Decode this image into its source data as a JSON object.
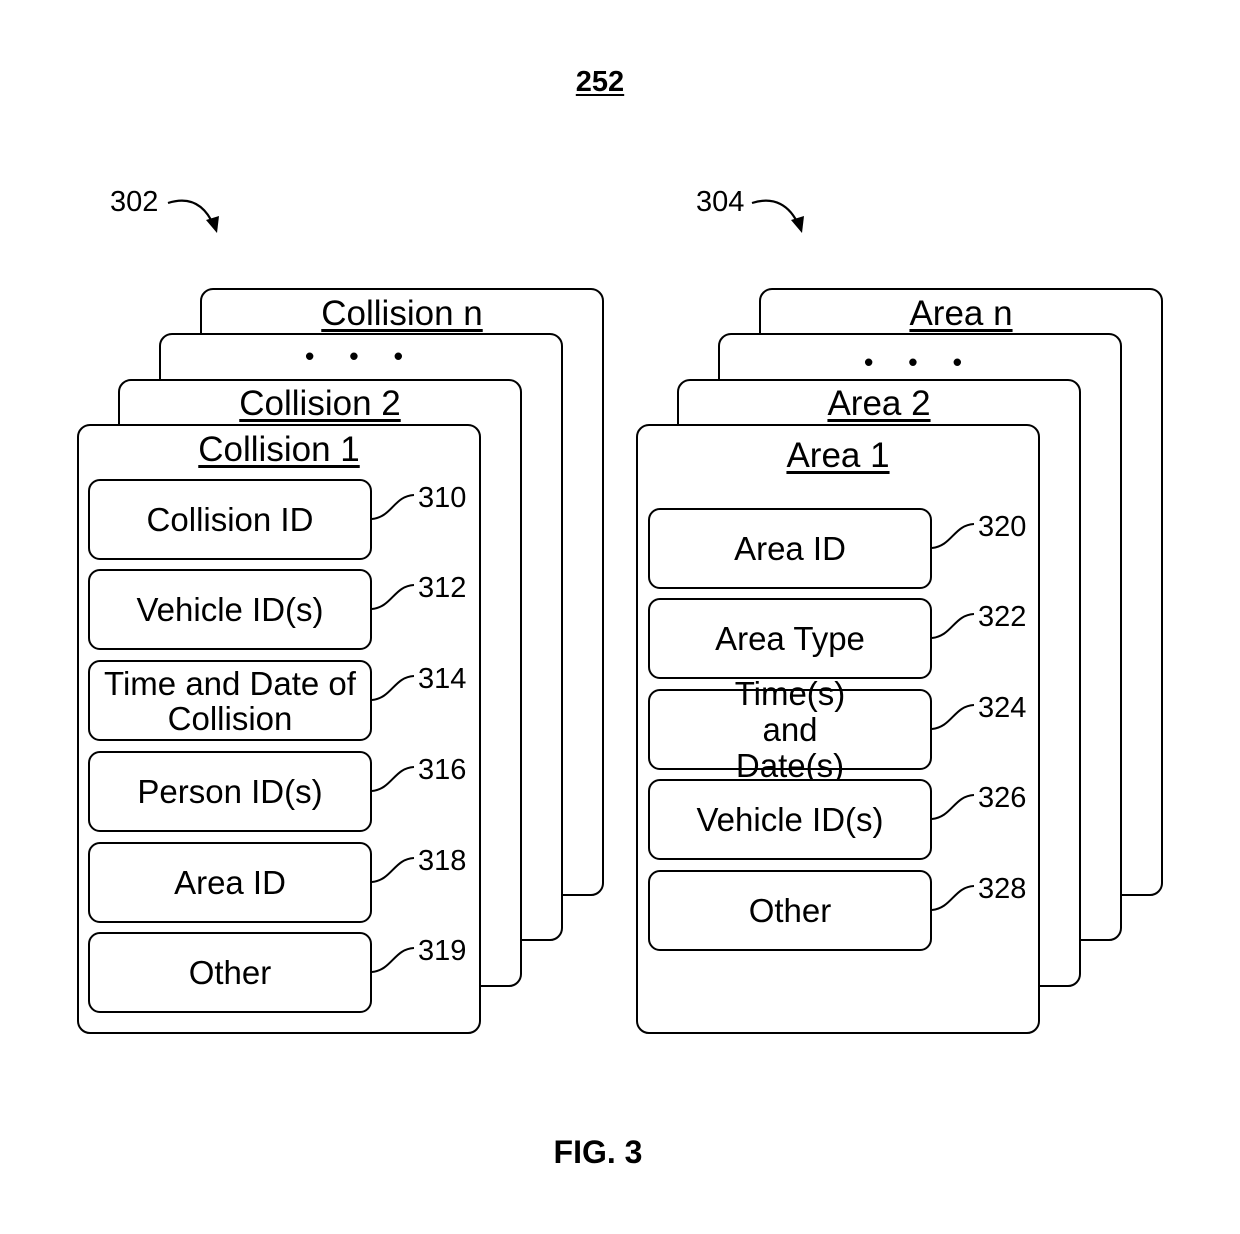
{
  "figure": {
    "number": "252",
    "caption": "FIG. 3"
  },
  "collisions": {
    "ref": "302",
    "stack_titles": [
      "Collision n",
      "• • •",
      "Collision 2"
    ],
    "front_title": "Collision 1",
    "fields": [
      {
        "label": "Collision ID",
        "ref": "310"
      },
      {
        "label": "Vehicle ID(s)",
        "ref": "312"
      },
      {
        "label": "Time and Date of Collision",
        "ref": "314"
      },
      {
        "label": "Person ID(s)",
        "ref": "316"
      },
      {
        "label": "Area ID",
        "ref": "318"
      },
      {
        "label": "Other",
        "ref": "319"
      }
    ]
  },
  "areas": {
    "ref": "304",
    "stack_titles": [
      "Area n",
      "• • •",
      "Area 2"
    ],
    "front_title": "Area 1",
    "fields": [
      {
        "label": "Area ID",
        "ref": "320"
      },
      {
        "label": "Area Type",
        "ref": "322"
      },
      {
        "label": "Time(s) and Date(s)",
        "ref": "324"
      },
      {
        "label": "Vehicle ID(s)",
        "ref": "326"
      },
      {
        "label": "Other",
        "ref": "328"
      }
    ]
  }
}
